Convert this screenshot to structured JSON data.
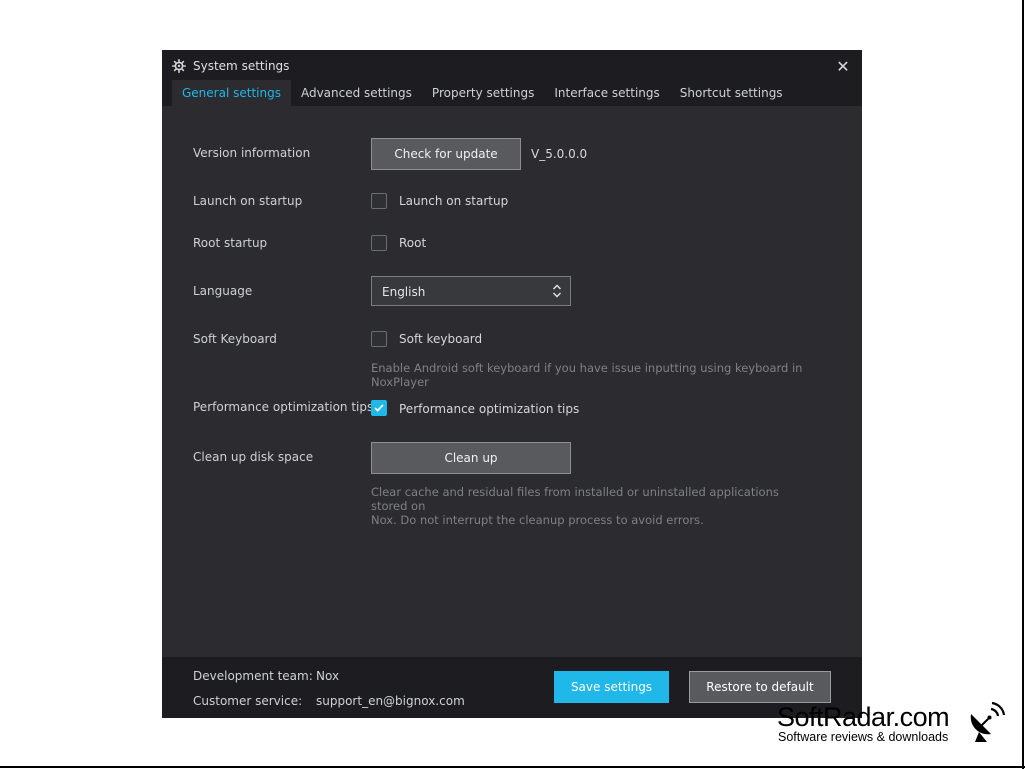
{
  "window": {
    "title": "System settings",
    "close_icon": "close-icon",
    "settings_icon": "gear-icon"
  },
  "tabs": [
    {
      "label": "General settings",
      "active": true
    },
    {
      "label": "Advanced settings",
      "active": false
    },
    {
      "label": "Property settings",
      "active": false
    },
    {
      "label": "Interface settings",
      "active": false
    },
    {
      "label": "Shortcut settings",
      "active": false
    }
  ],
  "general": {
    "version": {
      "label": "Version information",
      "button": "Check for update",
      "value": "V_5.0.0.0"
    },
    "launch": {
      "label": "Launch on startup",
      "checkbox_label": "Launch on startup",
      "checked": false
    },
    "root": {
      "label": "Root startup",
      "checkbox_label": "Root",
      "checked": false
    },
    "language": {
      "label": "Language",
      "selected": "English"
    },
    "soft_keyboard": {
      "label": "Soft Keyboard",
      "checkbox_label": "Soft keyboard",
      "checked": false,
      "help_line1": "Enable Android soft keyboard if you have issue inputting using keyboard in",
      "help_line2": "NoxPlayer"
    },
    "performance": {
      "label": "Performance optimization tips",
      "checkbox_label": "Performance optimization tips",
      "checked": true
    },
    "cleanup": {
      "label": "Clean up disk space",
      "button": "Clean up",
      "help_line1": "Clear cache and residual files from installed or uninstalled applications stored on",
      "help_line2": "Nox. Do not interrupt the cleanup process to avoid errors."
    }
  },
  "footer": {
    "dev_key": "Development team:",
    "dev_value": "Nox",
    "support_key": "Customer service:",
    "support_value": "support_en@bignox.com",
    "save_button": "Save settings",
    "restore_button": "Restore to default"
  },
  "watermark": {
    "name": "SoftRadar.com",
    "tagline": "Software reviews & downloads"
  },
  "colors": {
    "accent": "#1fb8e8",
    "window_bg": "#2b2b30",
    "titlebar_bg": "#1d1d21"
  }
}
